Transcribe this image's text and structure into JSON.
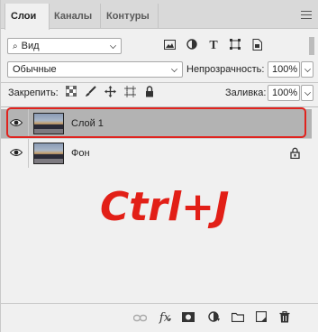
{
  "tabs": [
    {
      "label": "Слои"
    },
    {
      "label": "Каналы"
    },
    {
      "label": "Контуры"
    }
  ],
  "filter": {
    "kind_label": "Вид",
    "icons": [
      "image-filter-icon",
      "adjustment-filter-icon",
      "type-filter-icon",
      "shape-filter-icon",
      "smart-object-filter-icon"
    ]
  },
  "blend": {
    "mode": "Обычные",
    "opacity_label": "Непрозрачность:",
    "opacity_value": "100%"
  },
  "lock": {
    "label": "Закрепить:",
    "fill_label": "Заливка:",
    "fill_value": "100%"
  },
  "layers": [
    {
      "name": "Слой 1",
      "selected": true,
      "visible": true,
      "locked": false
    },
    {
      "name": "Фон",
      "selected": false,
      "visible": true,
      "locked": true
    }
  ],
  "overlay_text": "Ctrl+J",
  "colors": {
    "highlight": "#e0231e",
    "overlay_text": "#e21f17",
    "selected_row": "#b3b3b3"
  }
}
